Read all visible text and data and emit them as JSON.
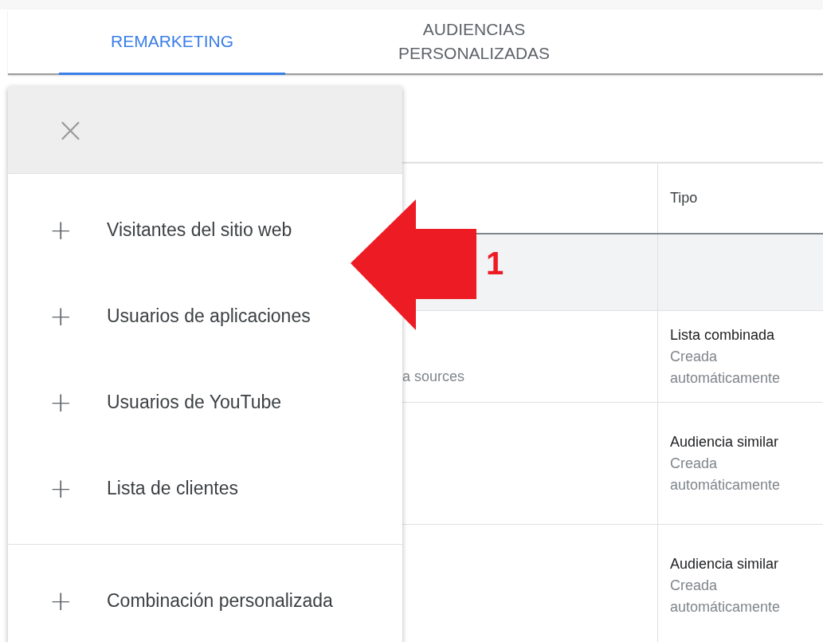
{
  "tabs": [
    {
      "label": "REMARKETING",
      "selected": true
    },
    {
      "label": "AUDIENCIAS PERSONALIZADAS",
      "selected": false
    }
  ],
  "menu": {
    "close": "×",
    "groups": [
      [
        {
          "icon": "+",
          "label": "Visitantes del sitio web"
        },
        {
          "icon": "+",
          "label": "Usuarios de aplicaciones"
        },
        {
          "icon": "+",
          "label": "Usuarios de YouTube"
        },
        {
          "icon": "+",
          "label": "Lista de clientes"
        }
      ],
      [
        {
          "icon": "+",
          "label": "Combinación personalizada"
        }
      ]
    ]
  },
  "table": {
    "columns": [
      "Tipo"
    ],
    "rows": [
      {
        "column_1": "a sources",
        "type": "Lista combinada",
        "type_note": "Creada automáticamente"
      },
      {
        "type": "Audiencia similar",
        "type_note": "Creada automáticamente"
      },
      {
        "type": "Audiencia similar",
        "type_note": "Creada automáticamente"
      }
    ]
  },
  "annotation": {
    "label": "1"
  }
}
